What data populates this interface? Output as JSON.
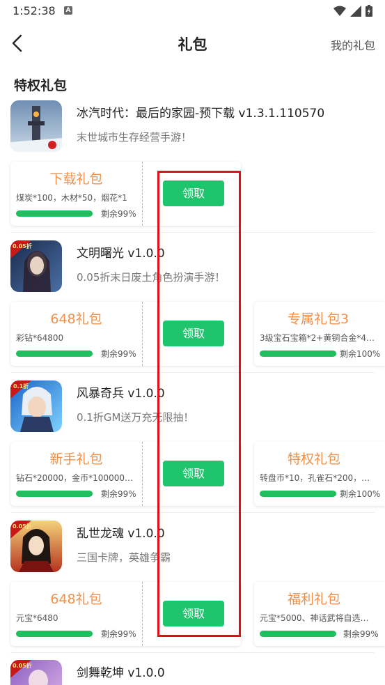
{
  "status_bar": {
    "time": "1:52:38",
    "notification_icon": "A"
  },
  "nav": {
    "title": "礼包",
    "right_link": "我的礼包"
  },
  "section_title": "特权礼包",
  "claim_label": "领取",
  "games": [
    {
      "title": "冰汽时代：最后的家园-预下载 v1.3.1.110570",
      "desc": "末世城市生存经营手游！",
      "gifts": [
        {
          "name": "下载礼包",
          "content": "煤炭*100，木材*50，烟花*1",
          "remain": "剩余99%",
          "progress": 0.99
        }
      ]
    },
    {
      "title": "文明曙光 v1.0.0",
      "desc": "0.05折末日废土角色扮演手游！",
      "badge": "0.05折",
      "gifts": [
        {
          "name": "648礼包",
          "content": "彩钻*64800",
          "remain": "剩余99%",
          "progress": 0.99
        },
        {
          "name": "专属礼包3",
          "content": "3级宝石宝箱*2+黄铜合金*4…",
          "remain": "剩余100%",
          "progress": 1.0
        }
      ]
    },
    {
      "title": "风暴奇兵 v1.0.0",
      "desc": "0.1折GM送万充无限抽！",
      "badge": "0.1折",
      "gifts": [
        {
          "name": "新手礼包",
          "content": "钻石*20000，金币*100000…",
          "remain": "剩余99%",
          "progress": 0.99
        },
        {
          "name": "特权礼包",
          "content": "转盘币*10，孔雀石*200，…",
          "remain": "剩余100%",
          "progress": 1.0
        }
      ]
    },
    {
      "title": "乱世龙魂 v1.0.0",
      "desc": "三国卡牌，英雄争霸",
      "badge": "0.05折",
      "gifts": [
        {
          "name": "648礼包",
          "content": "元宝*6480",
          "remain": "剩余99%",
          "progress": 0.99
        },
        {
          "name": "福利礼包",
          "content": "元宝*5000、神话武将自选…",
          "remain": "剩余99%",
          "progress": 0.99
        }
      ]
    },
    {
      "title": "剑舞乾坤 v1.0.0",
      "badge": "0.05折"
    }
  ],
  "colors": {
    "accent_green": "#1ec56c",
    "gift_orange": "#f0904a",
    "highlight_red": "#e0101a"
  }
}
